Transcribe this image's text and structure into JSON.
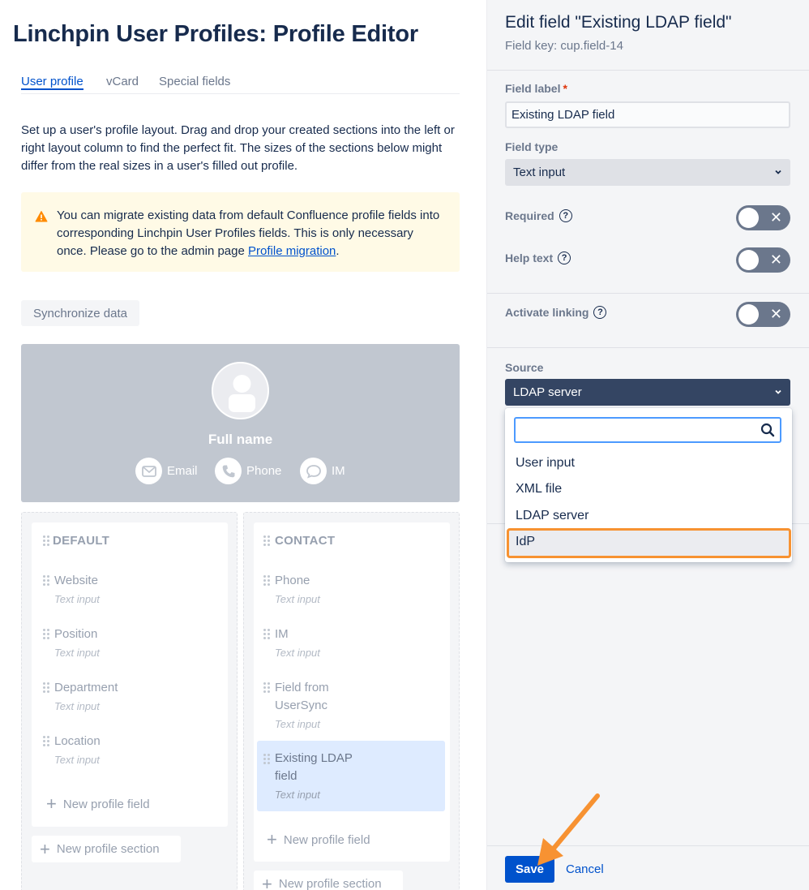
{
  "page_title": "Linchpin User Profiles: Profile Editor",
  "tabs": [
    "User profile",
    "vCard",
    "Special fields"
  ],
  "intro_text": "Set up a user's profile layout. Drag and drop your created sections into the left or right layout column to find the perfect fit. The sizes of the sections below might differ from the real sizes in a user's filled out profile.",
  "warning": {
    "text": "You can migrate existing data from default Confluence profile fields into corresponding Linchpin User Profiles fields. This is only necessary once. Please go to the admin page ",
    "link": "Profile migration",
    "suffix": ".",
    "icon": "warning-icon",
    "color": "#fffae6"
  },
  "sync_button": "Synchronize data",
  "profile_card": {
    "full_name": "Full name",
    "contacts": [
      {
        "label": "Email",
        "icon": "email-icon"
      },
      {
        "label": "Phone",
        "icon": "phone-icon"
      },
      {
        "label": "IM",
        "icon": "chat-icon"
      }
    ]
  },
  "sections": {
    "default": {
      "title": "DEFAULT",
      "fields": [
        {
          "name": "Website",
          "type": "Text input"
        },
        {
          "name": "Position",
          "type": "Text input"
        },
        {
          "name": "Department",
          "type": "Text input"
        },
        {
          "name": "Location",
          "type": "Text input"
        }
      ],
      "add_field": "New profile field"
    },
    "contact": {
      "title": "CONTACT",
      "fields": [
        {
          "name": "Phone",
          "type": "Text input"
        },
        {
          "name": "IM",
          "type": "Text input"
        },
        {
          "name_line1": "Field from",
          "name_line2": "UserSync",
          "type": "Text input"
        },
        {
          "name_line1": "Existing LDAP",
          "name_line2": "field",
          "type": "Text input"
        }
      ],
      "add_field": "New profile field"
    },
    "add_section": "New profile section"
  },
  "panel": {
    "title": "Edit field \"Existing LDAP field\"",
    "field_key": "Field key: cup.field-14",
    "field_label_label": "Field label",
    "required_star": "*",
    "field_label_value": "Existing LDAP field",
    "field_type_label": "Field type",
    "field_type_value": "Text input",
    "required_label": "Required",
    "help_text_label": "Help text",
    "activate_linking_label": "Activate linking",
    "source_label": "Source",
    "source_value": "LDAP server",
    "source_options": [
      "User input",
      "XML file",
      "LDAP server",
      "IdP"
    ],
    "search_placeholder": "",
    "save": "Save",
    "cancel": "Cancel"
  },
  "colors": {
    "primary": "#0052cc",
    "highlight": "#f79232",
    "dark_select": "#344563"
  }
}
